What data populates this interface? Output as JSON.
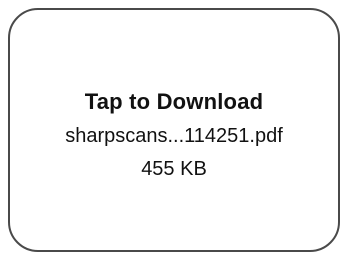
{
  "download_card": {
    "action_label": "Tap to Download",
    "file_name": "sharpscans...114251.pdf",
    "file_size": "455 KB"
  }
}
